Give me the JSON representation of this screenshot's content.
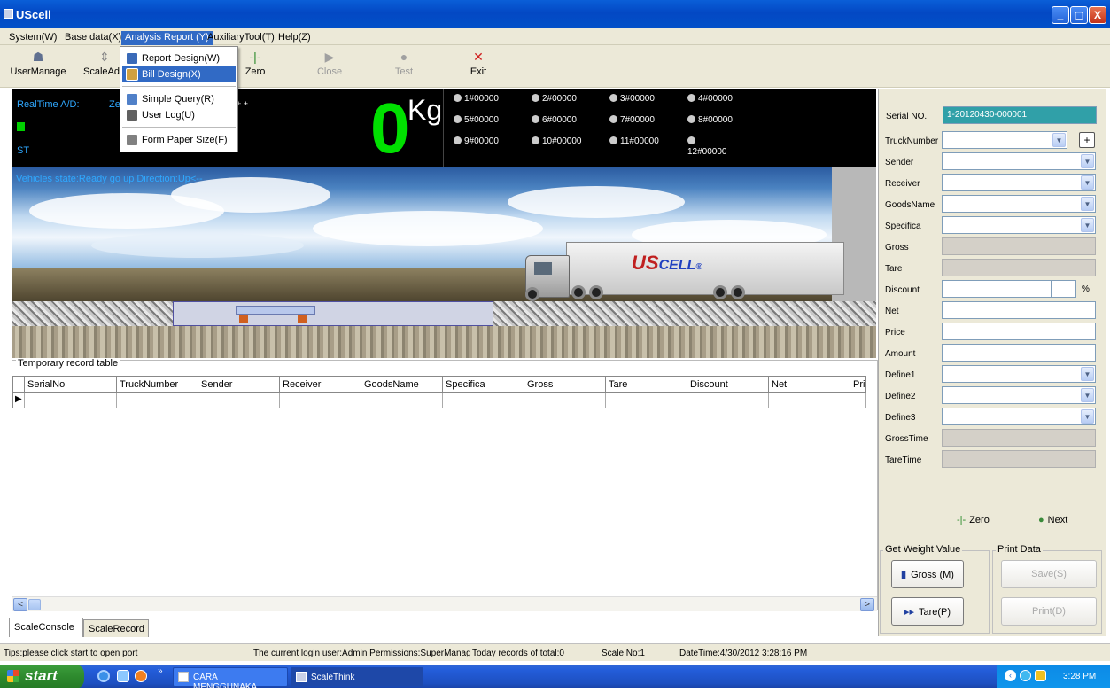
{
  "window": {
    "title": "UScell",
    "buttons": [
      "_",
      "▢",
      "X"
    ]
  },
  "menubar": [
    {
      "label": "System(W)"
    },
    {
      "label": "Base data(X)"
    },
    {
      "label": "Analysis Report (Y)"
    },
    {
      "label": "AuxiliaryTool(T)"
    },
    {
      "label": "Help(Z)"
    }
  ],
  "toolbar": {
    "usermanage": "UserManage",
    "scaleadjust": "ScaleAd",
    "zero": "Zero",
    "close": "Close",
    "test": "Test",
    "exit": "Exit"
  },
  "dropdown": [
    {
      "label": "Report Design(W)",
      "icon": "report-design-icon"
    },
    {
      "label": "Bill Design(X)",
      "icon": "bill-design-icon",
      "highlighted": true
    },
    {
      "label": "Simple Query(R)",
      "icon": "query-icon"
    },
    {
      "label": "User Log(U)",
      "icon": "user-log-icon"
    },
    {
      "label": "Form Paper Size(F)",
      "icon": "printer-icon"
    }
  ],
  "display": {
    "realtime_label": "RealTime A/D:",
    "realtime_frag": "Ze",
    "plus_frag": "+ +",
    "st_label": "ST",
    "weight": "0",
    "unit": "Kg",
    "channels": [
      "1#00000",
      "2#00000",
      "3#00000",
      "4#00000",
      "5#00000",
      "6#00000",
      "7#00000",
      "8#00000",
      "9#00000",
      "10#00000",
      "11#00000",
      "12#00000"
    ]
  },
  "scene": {
    "vehicle_state": "Vehicles state:Ready go up  Direction:Up<--",
    "brand_main": "US",
    "brand_rest": "CELL",
    "brand_mark": "®"
  },
  "table": {
    "legend": "Temporary record table",
    "columns": [
      "SerialNo",
      "TruckNumber",
      "Sender",
      "Receiver",
      "GoodsName",
      "Specifica",
      "Gross",
      "Tare",
      "Discount",
      "Net",
      "Pric"
    ]
  },
  "tabs": {
    "console": "ScaleConsole",
    "record": "ScaleRecord"
  },
  "form": {
    "serial_label": "Serial NO.",
    "serial_value": "1-20120430-000001",
    "fields": [
      {
        "label": "TruckNumber"
      },
      {
        "label": "Sender"
      },
      {
        "label": "Receiver"
      },
      {
        "label": "GoodsName"
      },
      {
        "label": "Specifica"
      },
      {
        "label": "Gross"
      },
      {
        "label": "Tare"
      },
      {
        "label": "Discount"
      },
      {
        "label": "Net"
      },
      {
        "label": "Price"
      },
      {
        "label": "Amount"
      },
      {
        "label": "Define1"
      },
      {
        "label": "Define2"
      },
      {
        "label": "Define3"
      },
      {
        "label": "GrossTime"
      },
      {
        "label": "TareTime"
      }
    ],
    "discount_unit": "%",
    "plus": "+",
    "zero": "Zero",
    "next": "Next",
    "get_weight_legend": "Get Weight Value",
    "print_legend": "Print Data",
    "gross_btn": "Gross (M)",
    "tare_btn": "Tare(P)",
    "save_btn": "Save(S)",
    "print_btn": "Print(D)"
  },
  "statusbar": {
    "tip": "Tips:please click start to open port",
    "login": "The current login user:Admin  Permissions:SuperManage",
    "today": "Today records of total:0",
    "scale": "Scale No:1",
    "datetime": "DateTime:4/30/2012 3:28:16 PM"
  },
  "taskbar": {
    "start": "start",
    "chevron": "»",
    "task1": "CARA MENGGUNAKA...",
    "task2": "ScaleThink",
    "clock": "3:28 PM"
  },
  "colors": {
    "accent": "#316ac5",
    "weight_green": "#00e000",
    "serial_teal": "#30a0a8",
    "titlebar": "#0348c4"
  }
}
